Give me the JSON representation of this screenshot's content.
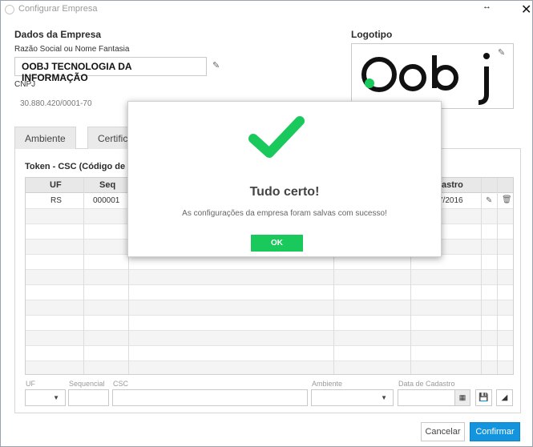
{
  "window": {
    "title": "Configurar Empresa",
    "resize_glyph": "↔",
    "close_glyph": "✕"
  },
  "company": {
    "section_title": "Dados da Empresa",
    "name_label": "Razão Social ou Nome Fantasia",
    "name_value": "OOBJ TECNOLOGIA DA INFORMAÇÃO",
    "cnpj_label": "CNPJ",
    "cnpj_value": "30.880.420/0001-70"
  },
  "logo": {
    "section_title": "Logotipo",
    "logo_text": "Oobj"
  },
  "tabs": [
    {
      "label": "Ambiente"
    },
    {
      "label": "Certific"
    }
  ],
  "token": {
    "title": "Token - CSC (Código de",
    "columns": [
      "UF",
      "Seq",
      "astro"
    ],
    "rows": [
      {
        "uf": "RS",
        "seq": "000001",
        "data": "7/2016"
      }
    ]
  },
  "form": {
    "uf_label": "UF",
    "seq_label": "Sequencial",
    "csc_label": "CSC",
    "ambiente_label": "Ambiente",
    "data_label": "Data de Cadastro"
  },
  "footer": {
    "cancel": "Cancelar",
    "confirm": "Confirmar"
  },
  "dialog": {
    "title": "Tudo certo!",
    "message": "As configurações da empresa foram salvas com sucesso!",
    "ok": "OK"
  },
  "colors": {
    "accent": "#1394dd",
    "success": "#1ac95c"
  }
}
